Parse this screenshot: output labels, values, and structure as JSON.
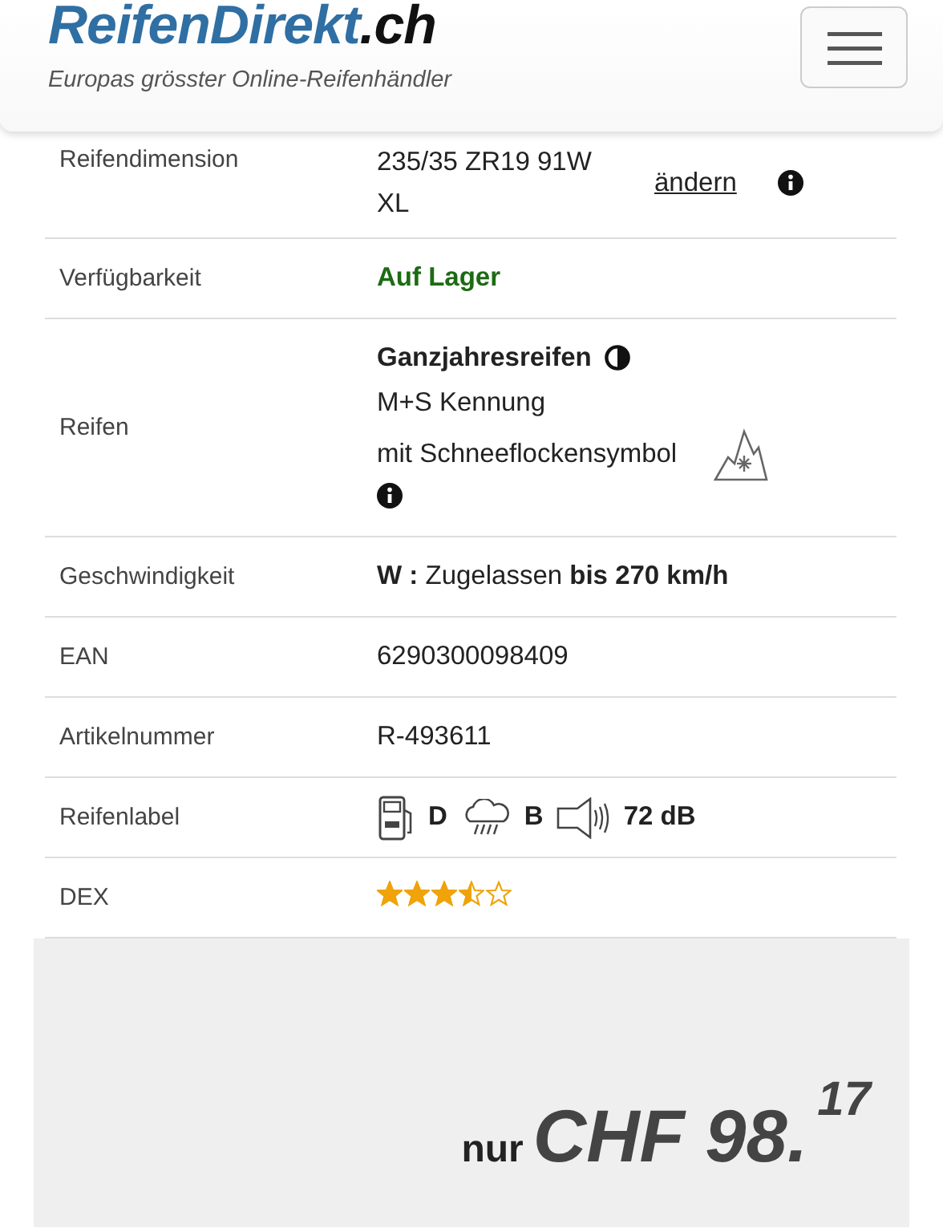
{
  "header": {
    "logo_main": "ReifenDirekt",
    "logo_suffix": ".ch",
    "tagline": "Europas grösster Online-Reifenhändler"
  },
  "rows": [
    {
      "kind": "dimension",
      "label": "Reifendimension",
      "value": "235/35 ZR19 91W XL",
      "link": "ändern"
    },
    {
      "kind": "availability",
      "label": "Verfügbarkeit",
      "value": "Auf Lager"
    },
    {
      "kind": "season",
      "label": "Reifen",
      "title": "Ganzjahresreifen",
      "lines": [
        "M+S Kennung",
        "mit Schneeflockensymbol"
      ]
    },
    {
      "kind": "rich",
      "label": "Geschwindigkeit",
      "value": "**W :** Zugelassen **bis 270 km/h**"
    },
    {
      "kind": "plain",
      "label": "EAN",
      "value": "6290300098409"
    },
    {
      "kind": "plain",
      "label": "Artikelnummer",
      "value": "R-493611"
    },
    {
      "kind": "eulabel",
      "label": "Reifenlabel",
      "fuel": "D",
      "wet": "B",
      "noise": "72 dB"
    },
    {
      "kind": "stars",
      "label": "DEX",
      "stars": 3.5
    }
  ],
  "price": {
    "prefix": "nur",
    "amount": "CHF 98.",
    "cents": "17"
  }
}
